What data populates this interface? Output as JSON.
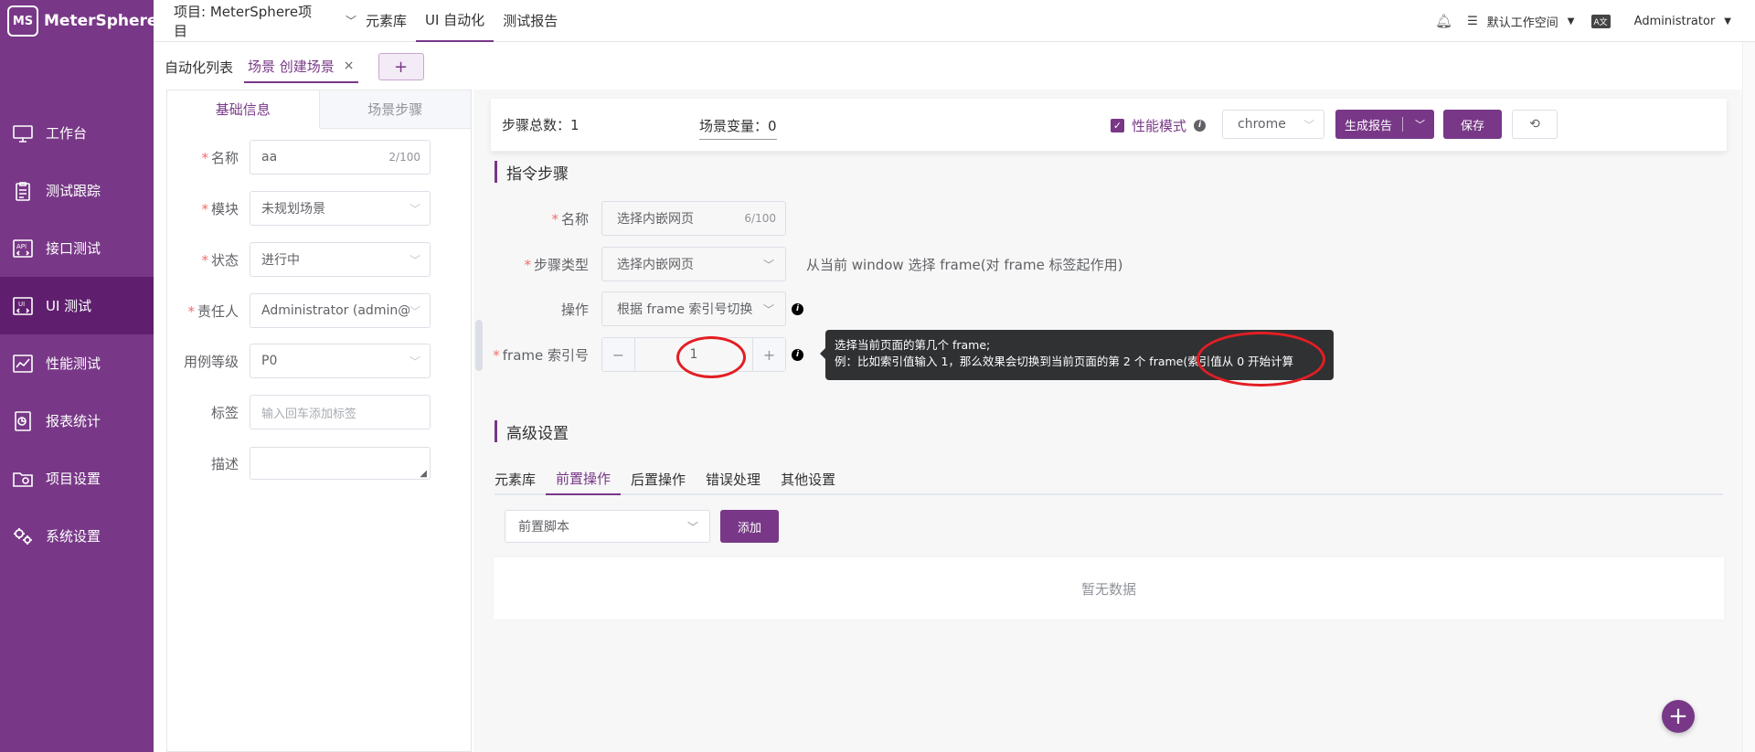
{
  "app": {
    "logo_mark": "MS",
    "logo_text": "MeterSphere"
  },
  "sidebar": {
    "items": [
      {
        "label": "工作台",
        "icon": "monitor-icon",
        "active": false
      },
      {
        "label": "测试跟踪",
        "icon": "clipboard-icon",
        "active": false
      },
      {
        "label": "接口测试",
        "icon": "api-icon",
        "active": false
      },
      {
        "label": "UI 测试",
        "icon": "ui-icon",
        "active": true
      },
      {
        "label": "性能测试",
        "icon": "chart-icon",
        "active": false
      },
      {
        "label": "报表统计",
        "icon": "report-icon",
        "active": false
      },
      {
        "label": "项目设置",
        "icon": "folder-gear-icon",
        "active": false
      },
      {
        "label": "系统设置",
        "icon": "gears-icon",
        "active": false
      }
    ]
  },
  "topbar": {
    "project": "项目: MeterSphere项目",
    "tabs": [
      "元素库",
      "UI 自动化",
      "测试报告"
    ],
    "active_tab": "UI 自动化",
    "workspace": "默认工作空间",
    "user": "Administrator"
  },
  "scenario_tabs": {
    "list_label": "自动化列表",
    "active_label": "场景 创建场景",
    "close": "×",
    "add": "+"
  },
  "left_panel": {
    "tabs": [
      "基础信息",
      "场景步骤"
    ],
    "fields": {
      "name": {
        "label": "名称",
        "value": "aa",
        "count": "2/100"
      },
      "module": {
        "label": "模块",
        "value": "未规划场景"
      },
      "status": {
        "label": "状态",
        "value": "进行中"
      },
      "owner": {
        "label": "责任人",
        "value": "Administrator (admin@"
      },
      "level": {
        "label": "用例等级",
        "value": "P0"
      },
      "tags": {
        "label": "标签",
        "placeholder": "输入回车添加标签"
      },
      "desc": {
        "label": "描述"
      }
    }
  },
  "statbar": {
    "steps_total": "步骤总数：1",
    "scene_vars": "场景变量：0",
    "perf_mode": "性能模式",
    "browser": "chrome",
    "report_btn": "生成报告",
    "save_btn": "保存",
    "refresh": "⟲"
  },
  "command_steps": {
    "title": "指令步骤",
    "name": {
      "label": "名称",
      "value": "选择内嵌网页",
      "count": "6/100"
    },
    "step_type": {
      "label": "步骤类型",
      "value": "选择内嵌网页",
      "hint": "从当前 window 选择 frame(对 frame 标签起作用)"
    },
    "operation": {
      "label": "操作",
      "value": "根据 frame 索引号切换"
    },
    "frame_index": {
      "label": "frame 索引号",
      "value": "1",
      "minus": "−",
      "plus": "+"
    },
    "tooltip_line1": "选择当前页面的第几个 frame;",
    "tooltip_line2": "例：比如索引值输入 1，那么效果会切换到当前页面的第 2 个 frame(索引值从 0 开始计算"
  },
  "advanced": {
    "title": "高级设置",
    "tabs": [
      "元素库",
      "前置操作",
      "后置操作",
      "错误处理",
      "其他设置"
    ],
    "active_tab": "前置操作",
    "pre_script": "前置脚本",
    "add_btn": "添加",
    "empty": "暂无数据"
  },
  "fab": "+",
  "colors": {
    "brand": "#783887",
    "sidebar_active": "#5f1f6e",
    "annotation": "#e31e24"
  }
}
